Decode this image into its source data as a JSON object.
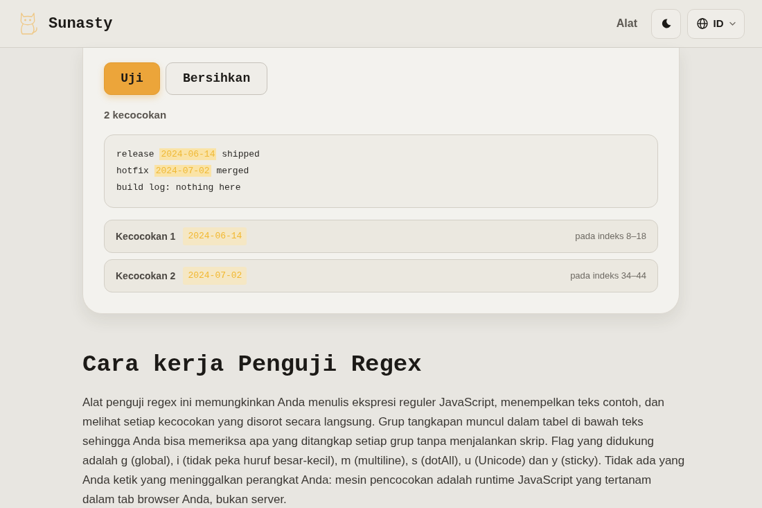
{
  "header": {
    "brand": "Sunasty",
    "nav_link": "Alat",
    "language": "ID"
  },
  "actions": [
    {
      "label": "Uji",
      "kind": "primary"
    },
    {
      "label": "Bersihkan",
      "kind": "secondary"
    }
  ],
  "match_count": "2 kecocokan",
  "sample_text": {
    "lines": [
      {
        "segments": [
          {
            "text": "release",
            "highlighted": false
          },
          {
            "text": "2024-06-14",
            "highlighted": true
          },
          {
            "text": "shipped",
            "highlighted": false
          }
        ]
      },
      {
        "segments": [
          {
            "text": "hotfix",
            "highlighted": false
          },
          {
            "text": "2024-07-02",
            "highlighted": true
          },
          {
            "text": "merged",
            "highlighted": false
          }
        ]
      },
      {
        "segments": [
          {
            "text": "build log: nothing here",
            "highlighted": false
          }
        ]
      }
    ]
  },
  "matches": [
    {
      "label": "Kecocokan 1",
      "value": "2024-06-14",
      "position": "pada indeks 8–18"
    },
    {
      "label": "Kecocokan 2",
      "value": "2024-07-02",
      "position": "pada indeks 34–44"
    }
  ],
  "article": {
    "heading": "Cara kerja Penguji Regex",
    "paragraph": "Alat penguji regex ini memungkinkan Anda menulis ekspresi reguler JavaScript, menempelkan teks contoh, dan melihat setiap kecocokan yang disorot secara langsung. Grup tangkapan muncul dalam tabel di bawah teks sehingga Anda bisa memeriksa apa yang ditangkap setiap grup tanpa menjalankan skrip. Flag yang didukung adalah g (global), i (tidak peka huruf besar-kecil), m (multiline), s (dotAll), u (Unicode) dan y (sticky). Tidak ada yang Anda ketik yang meninggalkan perangkat Anda: mesin pencocokan adalah runtime JavaScript yang tertanam dalam tab browser Anda, bukan server."
  }
}
